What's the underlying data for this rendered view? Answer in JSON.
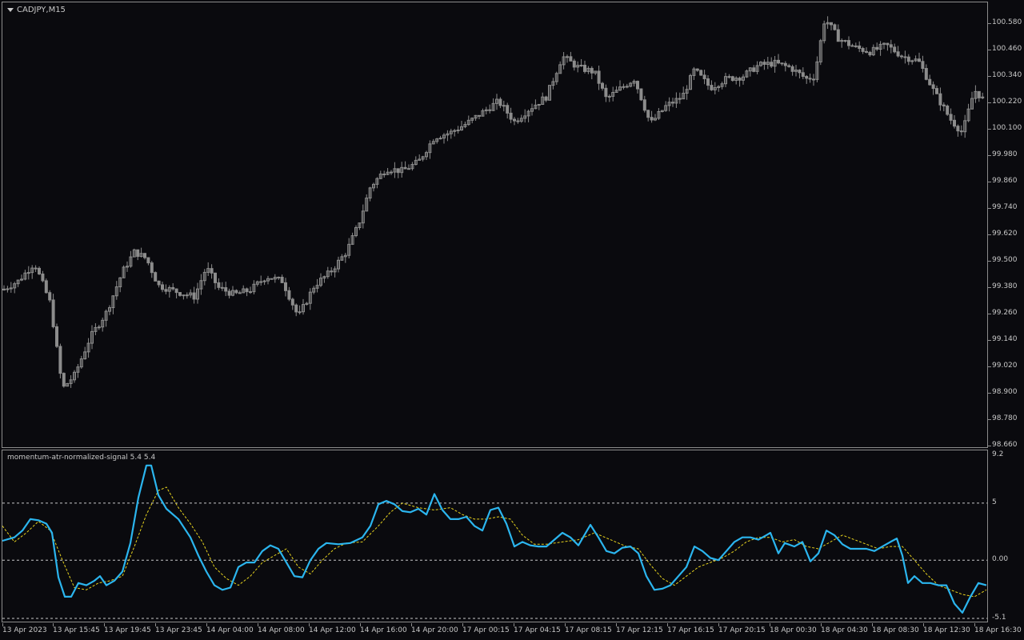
{
  "symbol_label": "CADJPY,M15",
  "colors": {
    "background": "#0a0a0e",
    "candle": "#8c8c8c",
    "signal_line": "#2bb5ee",
    "signal_ma": "#e6d21e",
    "level_lines": "#c8c8c8"
  },
  "price_axis": [
    "100.580",
    "100.460",
    "100.340",
    "100.220",
    "100.100",
    "99.980",
    "99.860",
    "99.740",
    "99.620",
    "99.500",
    "99.380",
    "99.260",
    "99.140",
    "99.020",
    "98.900",
    "98.780",
    "98.660"
  ],
  "indicator": {
    "title": "momentum-atr-normalized-signal 5.4 5.4",
    "axis": [
      "9.2",
      "5",
      "0.00",
      "-5.1"
    ]
  },
  "time_axis": [
    "13 Apr 2023",
    "13 Apr 15:45",
    "13 Apr 19:45",
    "13 Apr 23:45",
    "14 Apr 04:00",
    "14 Apr 08:00",
    "14 Apr 12:00",
    "14 Apr 16:00",
    "14 Apr 20:00",
    "17 Apr 00:15",
    "17 Apr 04:15",
    "17 Apr 08:15",
    "17 Apr 12:15",
    "17 Apr 16:15",
    "17 Apr 20:15",
    "18 Apr 00:30",
    "18 Apr 04:30",
    "18 Apr 08:30",
    "18 Apr 12:30",
    "18 Apr 16:30"
  ],
  "chart_data": [
    {
      "type": "candlestick",
      "title": "CADJPY,M15",
      "ylim": [
        98.66,
        100.64
      ],
      "close_path": [
        [
          0,
          99.36
        ],
        [
          20,
          99.4
        ],
        [
          40,
          99.48
        ],
        [
          60,
          99.3
        ],
        [
          75,
          98.92
        ],
        [
          90,
          98.98
        ],
        [
          110,
          99.15
        ],
        [
          130,
          99.26
        ],
        [
          150,
          99.44
        ],
        [
          165,
          99.53
        ],
        [
          180,
          99.5
        ],
        [
          195,
          99.38
        ],
        [
          220,
          99.35
        ],
        [
          240,
          99.33
        ],
        [
          255,
          99.46
        ],
        [
          270,
          99.37
        ],
        [
          290,
          99.34
        ],
        [
          310,
          99.36
        ],
        [
          330,
          99.42
        ],
        [
          350,
          99.4
        ],
        [
          370,
          99.24
        ],
        [
          390,
          99.38
        ],
        [
          410,
          99.44
        ],
        [
          430,
          99.53
        ],
        [
          445,
          99.65
        ],
        [
          460,
          99.82
        ],
        [
          480,
          99.9
        ],
        [
          500,
          99.89
        ],
        [
          520,
          99.93
        ],
        [
          540,
          100.04
        ],
        [
          560,
          100.06
        ],
        [
          580,
          100.1
        ],
        [
          600,
          100.15
        ],
        [
          620,
          100.2
        ],
        [
          640,
          100.11
        ],
        [
          660,
          100.17
        ],
        [
          680,
          100.22
        ],
        [
          700,
          100.4
        ],
        [
          720,
          100.35
        ],
        [
          740,
          100.33
        ],
        [
          755,
          100.21
        ],
        [
          770,
          100.25
        ],
        [
          790,
          100.3
        ],
        [
          810,
          100.1
        ],
        [
          830,
          100.18
        ],
        [
          850,
          100.22
        ],
        [
          865,
          100.34
        ],
        [
          885,
          100.26
        ],
        [
          905,
          100.3
        ],
        [
          925,
          100.31
        ],
        [
          945,
          100.36
        ],
        [
          965,
          100.37
        ],
        [
          985,
          100.35
        ],
        [
          1005,
          100.3
        ],
        [
          1015,
          100.31
        ],
        [
          1028,
          100.57
        ],
        [
          1045,
          100.48
        ],
        [
          1065,
          100.44
        ],
        [
          1085,
          100.42
        ],
        [
          1105,
          100.45
        ],
        [
          1125,
          100.4
        ],
        [
          1145,
          100.38
        ],
        [
          1165,
          100.24
        ],
        [
          1185,
          100.12
        ],
        [
          1200,
          100.06
        ],
        [
          1215,
          100.25
        ],
        [
          1228,
          100.2
        ]
      ]
    },
    {
      "type": "line",
      "title": "momentum-atr-normalized-signal 5.4 5.4",
      "ylim": [
        -5.1,
        9.2
      ],
      "levels": [
        5,
        0,
        -5.1
      ],
      "series": [
        {
          "values": [
            [
              0,
              1.7
            ],
            [
              15,
              2.0
            ],
            [
              25,
              2.6
            ],
            [
              35,
              3.6
            ],
            [
              45,
              3.5
            ],
            [
              55,
              3.2
            ],
            [
              62,
              2.4
            ],
            [
              70,
              -1.5
            ],
            [
              78,
              -3.2
            ],
            [
              86,
              -3.2
            ],
            [
              95,
              -2.0
            ],
            [
              105,
              -2.2
            ],
            [
              115,
              -1.8
            ],
            [
              122,
              -1.4
            ],
            [
              130,
              -2.2
            ],
            [
              140,
              -1.8
            ],
            [
              150,
              -1.0
            ],
            [
              160,
              1.5
            ],
            [
              170,
              5.5
            ],
            [
              180,
              8.3
            ],
            [
              186,
              8.3
            ],
            [
              195,
              5.7
            ],
            [
              205,
              4.5
            ],
            [
              220,
              3.6
            ],
            [
              235,
              2.0
            ],
            [
              245,
              0.4
            ],
            [
              255,
              -1.0
            ],
            [
              265,
              -2.2
            ],
            [
              275,
              -2.6
            ],
            [
              285,
              -2.4
            ],
            [
              295,
              -0.6
            ],
            [
              305,
              -0.2
            ],
            [
              315,
              -0.2
            ],
            [
              325,
              0.8
            ],
            [
              335,
              1.3
            ],
            [
              345,
              1.0
            ],
            [
              355,
              -0.2
            ],
            [
              365,
              -1.4
            ],
            [
              375,
              -1.5
            ],
            [
              385,
              0.0
            ],
            [
              395,
              1.0
            ],
            [
              405,
              1.5
            ],
            [
              420,
              1.4
            ],
            [
              435,
              1.5
            ],
            [
              450,
              2.0
            ],
            [
              460,
              3.0
            ],
            [
              470,
              4.9
            ],
            [
              480,
              5.2
            ],
            [
              490,
              4.9
            ],
            [
              500,
              4.3
            ],
            [
              510,
              4.2
            ],
            [
              520,
              4.5
            ],
            [
              530,
              4.0
            ],
            [
              540,
              5.8
            ],
            [
              550,
              4.4
            ],
            [
              560,
              3.6
            ],
            [
              570,
              3.6
            ],
            [
              580,
              3.8
            ],
            [
              590,
              3.0
            ],
            [
              600,
              2.6
            ],
            [
              610,
              4.4
            ],
            [
              620,
              4.6
            ],
            [
              630,
              3.2
            ],
            [
              640,
              1.2
            ],
            [
              650,
              1.6
            ],
            [
              660,
              1.3
            ],
            [
              670,
              1.2
            ],
            [
              680,
              1.2
            ],
            [
              690,
              1.8
            ],
            [
              700,
              2.4
            ],
            [
              710,
              2.0
            ],
            [
              720,
              1.3
            ],
            [
              735,
              3.1
            ],
            [
              745,
              2.0
            ],
            [
              755,
              0.8
            ],
            [
              765,
              0.6
            ],
            [
              775,
              1.1
            ],
            [
              785,
              1.2
            ],
            [
              795,
              0.6
            ],
            [
              805,
              -1.4
            ],
            [
              815,
              -2.6
            ],
            [
              825,
              -2.5
            ],
            [
              835,
              -2.2
            ],
            [
              845,
              -1.4
            ],
            [
              855,
              -0.6
            ],
            [
              865,
              1.2
            ],
            [
              875,
              0.8
            ],
            [
              885,
              0.2
            ],
            [
              895,
              0.0
            ],
            [
              905,
              0.8
            ],
            [
              915,
              1.6
            ],
            [
              925,
              2.0
            ],
            [
              935,
              2.0
            ],
            [
              945,
              1.8
            ],
            [
              955,
              2.2
            ],
            [
              960,
              2.4
            ],
            [
              970,
              0.6
            ],
            [
              978,
              1.5
            ],
            [
              990,
              1.2
            ],
            [
              1000,
              1.6
            ],
            [
              1010,
              -0.1
            ],
            [
              1020,
              0.6
            ],
            [
              1030,
              2.6
            ],
            [
              1040,
              2.2
            ],
            [
              1050,
              1.4
            ],
            [
              1060,
              1.0
            ],
            [
              1070,
              1.0
            ],
            [
              1080,
              1.0
            ],
            [
              1090,
              0.8
            ],
            [
              1100,
              1.2
            ],
            [
              1110,
              1.6
            ],
            [
              1118,
              1.9
            ],
            [
              1125,
              0.4
            ],
            [
              1132,
              -2.0
            ],
            [
              1140,
              -1.4
            ],
            [
              1150,
              -2.0
            ],
            [
              1160,
              -2.0
            ],
            [
              1170,
              -2.2
            ],
            [
              1180,
              -2.2
            ],
            [
              1190,
              -3.8
            ],
            [
              1200,
              -4.6
            ],
            [
              1210,
              -3.2
            ],
            [
              1220,
              -2.0
            ],
            [
              1230,
              -2.2
            ]
          ]
        },
        {
          "values": [
            [
              0,
              3.0
            ],
            [
              15,
              1.6
            ],
            [
              30,
              2.4
            ],
            [
              45,
              3.4
            ],
            [
              60,
              2.6
            ],
            [
              75,
              0.0
            ],
            [
              90,
              -2.4
            ],
            [
              105,
              -2.6
            ],
            [
              120,
              -2.0
            ],
            [
              135,
              -1.8
            ],
            [
              150,
              -1.4
            ],
            [
              165,
              1.2
            ],
            [
              180,
              4.0
            ],
            [
              195,
              6.1
            ],
            [
              205,
              6.4
            ],
            [
              220,
              4.6
            ],
            [
              235,
              3.2
            ],
            [
              250,
              1.6
            ],
            [
              265,
              -0.6
            ],
            [
              280,
              -1.6
            ],
            [
              295,
              -2.2
            ],
            [
              310,
              -1.4
            ],
            [
              325,
              -0.2
            ],
            [
              340,
              0.4
            ],
            [
              355,
              1.0
            ],
            [
              370,
              -0.6
            ],
            [
              385,
              -1.2
            ],
            [
              400,
              0.0
            ],
            [
              415,
              1.0
            ],
            [
              430,
              1.5
            ],
            [
              450,
              1.6
            ],
            [
              470,
              3.0
            ],
            [
              485,
              4.2
            ],
            [
              500,
              5.0
            ],
            [
              520,
              4.6
            ],
            [
              540,
              4.4
            ],
            [
              560,
              4.6
            ],
            [
              575,
              4.0
            ],
            [
              590,
              3.6
            ],
            [
              605,
              3.6
            ],
            [
              620,
              3.8
            ],
            [
              635,
              3.6
            ],
            [
              650,
              2.2
            ],
            [
              665,
              1.4
            ],
            [
              680,
              1.4
            ],
            [
              700,
              1.6
            ],
            [
              720,
              1.8
            ],
            [
              740,
              2.4
            ],
            [
              760,
              1.8
            ],
            [
              780,
              1.2
            ],
            [
              795,
              1.0
            ],
            [
              810,
              -0.4
            ],
            [
              825,
              -1.6
            ],
            [
              840,
              -2.2
            ],
            [
              855,
              -1.4
            ],
            [
              870,
              -0.6
            ],
            [
              885,
              -0.2
            ],
            [
              900,
              0.2
            ],
            [
              915,
              0.8
            ],
            [
              930,
              1.6
            ],
            [
              945,
              2.0
            ],
            [
              960,
              2.0
            ],
            [
              975,
              1.6
            ],
            [
              990,
              1.8
            ],
            [
              1005,
              1.2
            ],
            [
              1020,
              1.0
            ],
            [
              1035,
              1.6
            ],
            [
              1050,
              2.2
            ],
            [
              1065,
              1.8
            ],
            [
              1080,
              1.4
            ],
            [
              1095,
              1.0
            ],
            [
              1110,
              1.2
            ],
            [
              1125,
              1.2
            ],
            [
              1140,
              0.0
            ],
            [
              1155,
              -1.2
            ],
            [
              1170,
              -2.2
            ],
            [
              1185,
              -2.6
            ],
            [
              1200,
              -3.0
            ],
            [
              1215,
              -3.2
            ],
            [
              1230,
              -2.6
            ]
          ]
        }
      ]
    }
  ]
}
